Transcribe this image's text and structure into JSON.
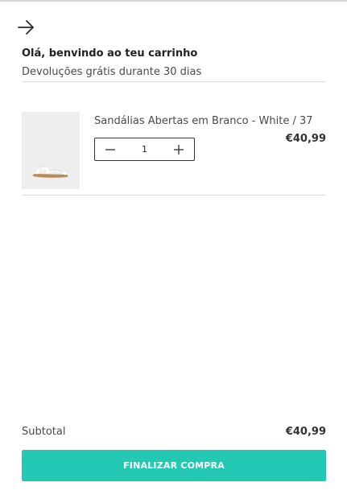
{
  "header": {
    "greeting": "Olá, benvindo ao teu carrinho",
    "returns_note": "Devoluções grátis durante 30 dias",
    "back_icon": "arrow-right-icon"
  },
  "cart": {
    "items": [
      {
        "name": "Sandálias Abertas em Branco - White / 37",
        "price": "€40,99",
        "quantity": "1",
        "image": "white-sandal-thumbnail"
      }
    ]
  },
  "summary": {
    "subtotal_label": "Subtotal",
    "subtotal_value": "€40,99",
    "checkout_label": "FINALIZAR COMPRA"
  },
  "colors": {
    "accent": "#23c9b2",
    "divider": "#d9d9d9",
    "thumb_bg": "#eeeeee"
  }
}
